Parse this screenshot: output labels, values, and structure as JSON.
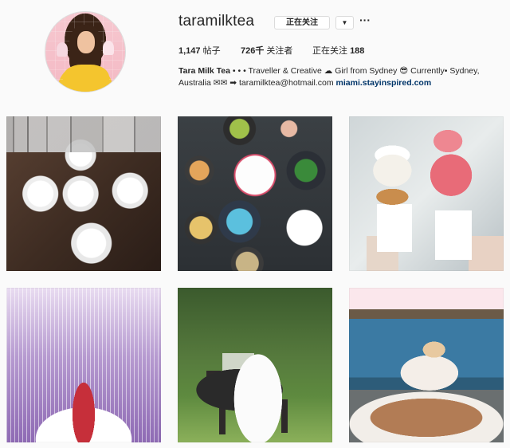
{
  "profile": {
    "username": "taramilktea",
    "follow_label": "正在关注",
    "dropdown_glyph": "▼",
    "more_glyph": "···",
    "stats": {
      "posts_value": "1,147",
      "posts_label": "帖子",
      "followers_value": "726千",
      "followers_label": "关注者",
      "following_label": "正在关注",
      "following_value": "188"
    },
    "bio": {
      "name": "Tara Milk Tea",
      "line1_rest": " • • • Traveller & Creative ☁ Girl from Sydney 😎 Currently• Sydney,",
      "line2": "Australia ✉✉ ➡ taramilktea@hotmail.com ",
      "link": "miami.stayinspired.com"
    }
  },
  "grid": {
    "posts": [
      {
        "subject": "latte art cups"
      },
      {
        "subject": "food flat lay"
      },
      {
        "subject": "ice cream cones"
      },
      {
        "subject": "light installation"
      },
      {
        "subject": "bride on horse"
      },
      {
        "subject": "beach picnic"
      }
    ]
  }
}
